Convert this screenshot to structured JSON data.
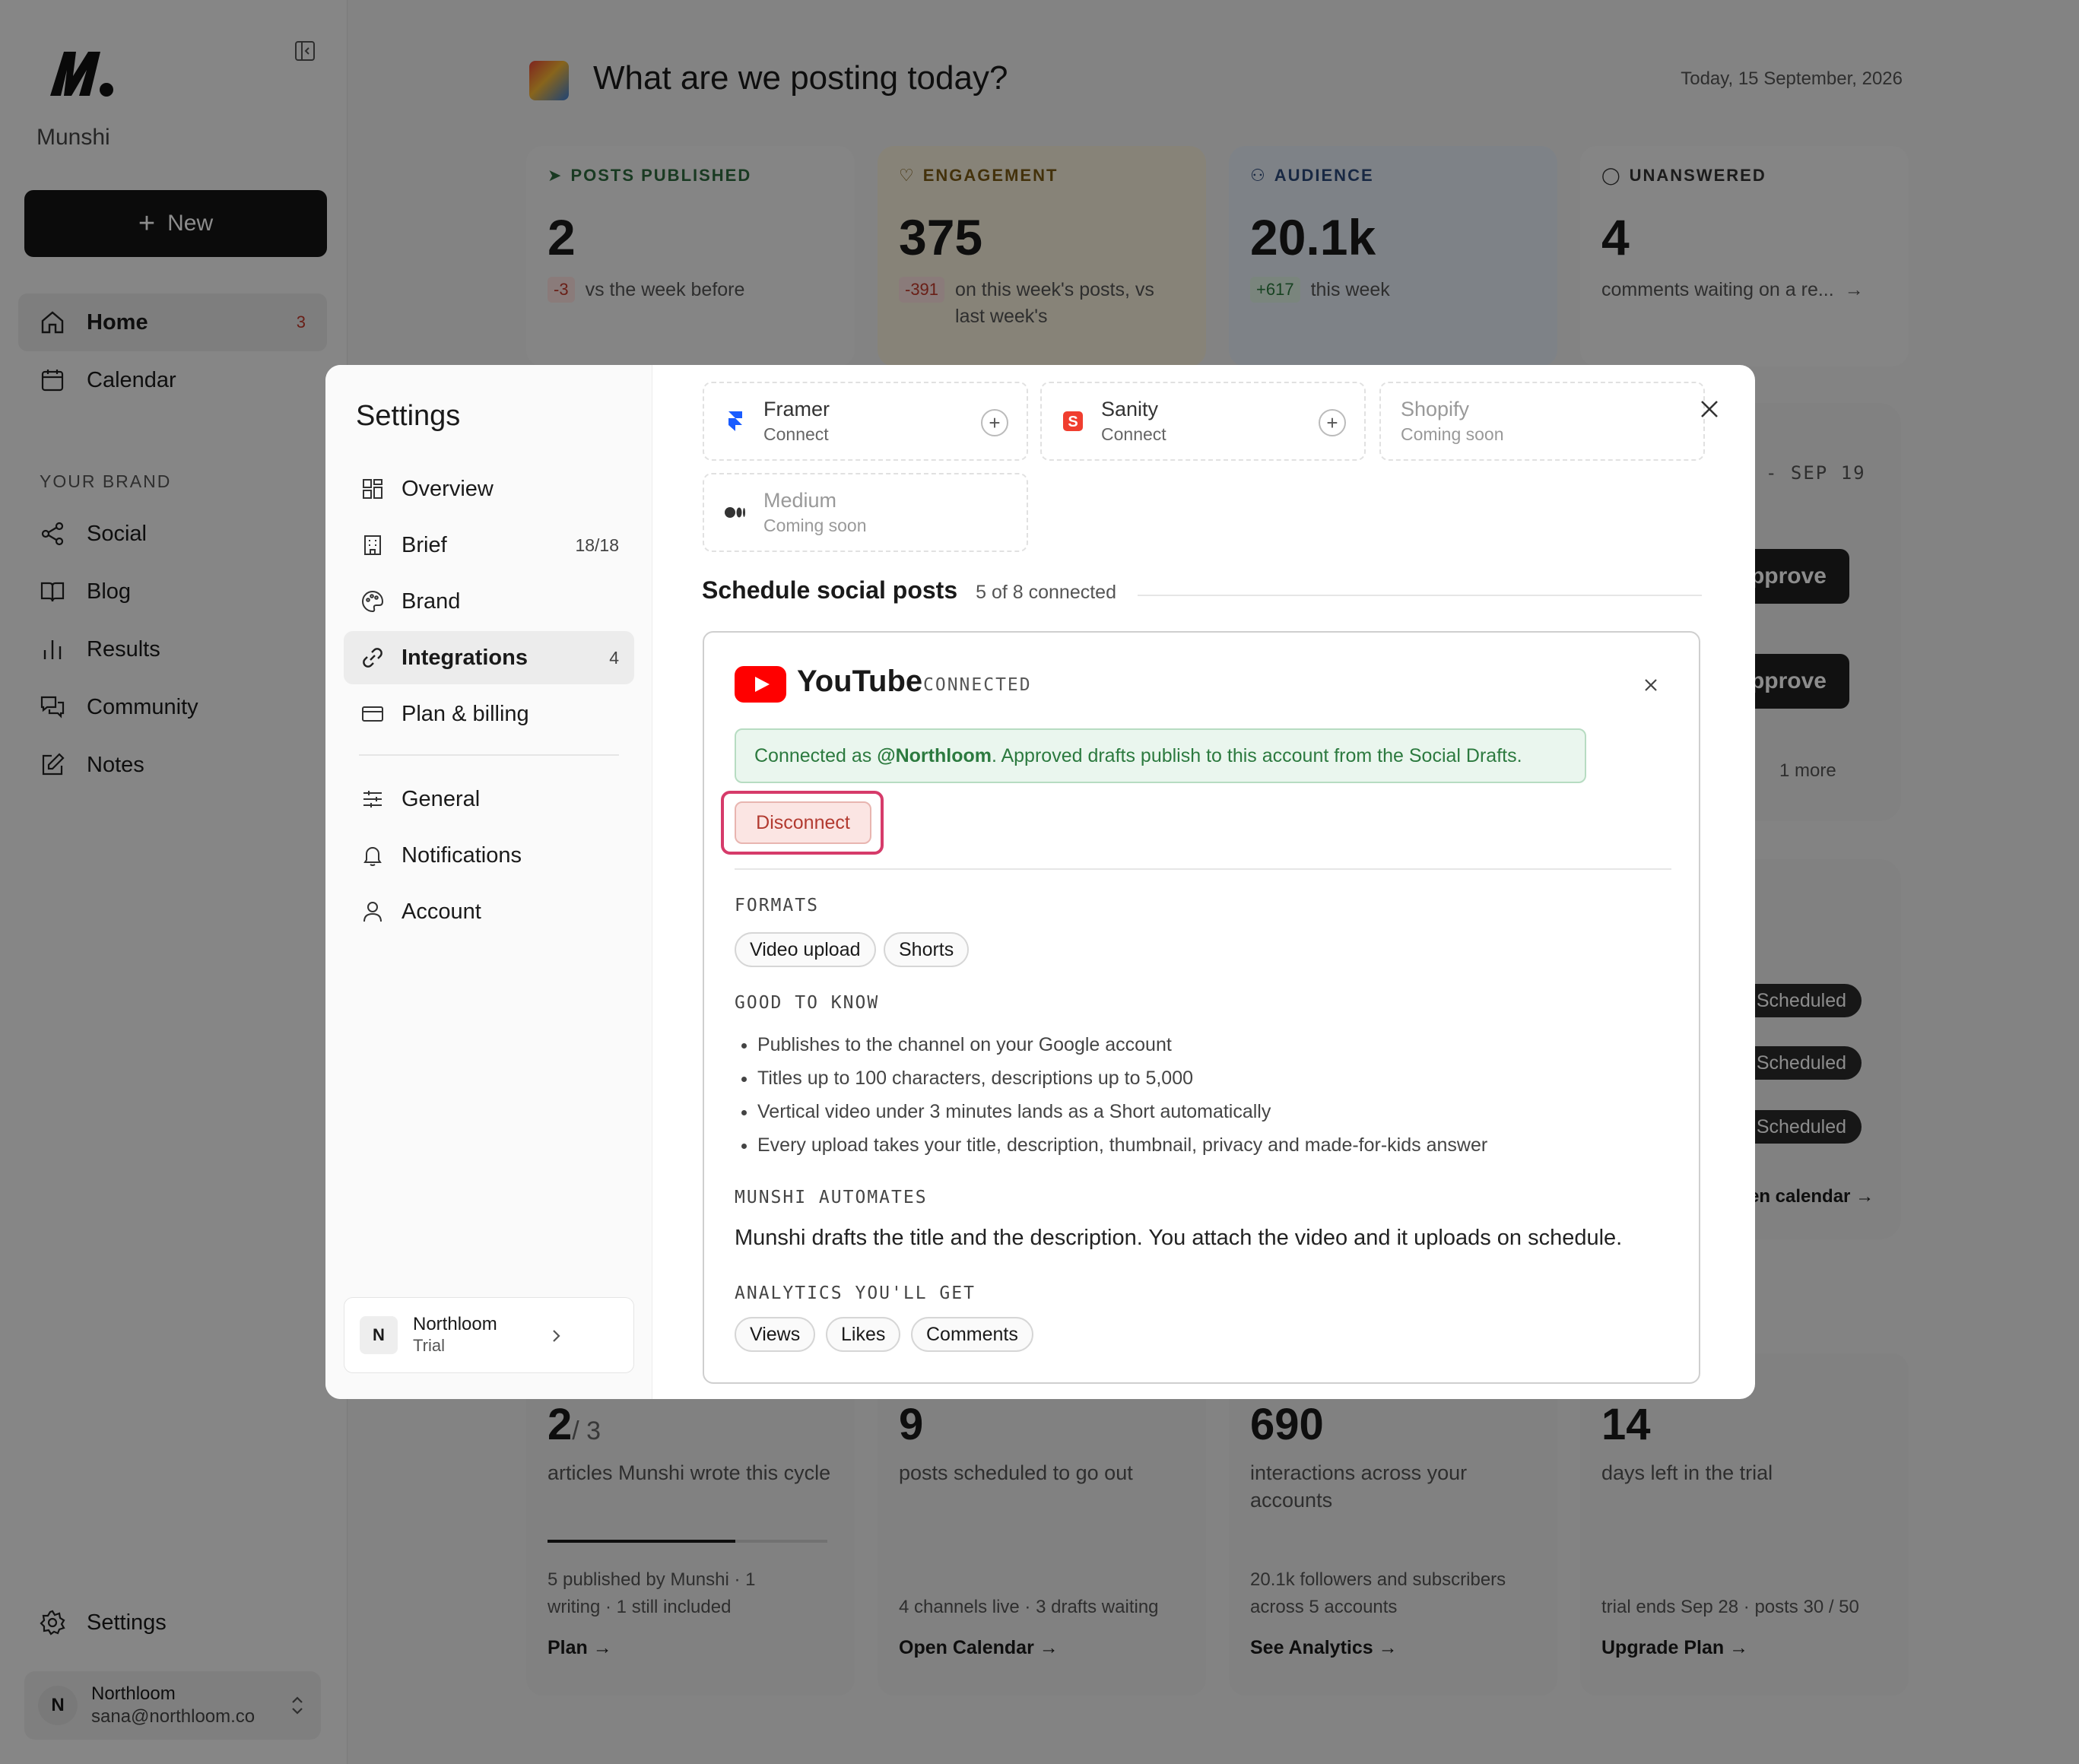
{
  "sidebar": {
    "brand": "Munshi",
    "new_label": "New",
    "nav": [
      {
        "label": "Home",
        "badge": "3"
      },
      {
        "label": "Calendar"
      }
    ],
    "section_label": "YOUR BRAND",
    "brand_nav": [
      {
        "label": "Social"
      },
      {
        "label": "Blog"
      },
      {
        "label": "Results"
      },
      {
        "label": "Community"
      },
      {
        "label": "Notes"
      }
    ],
    "settings_label": "Settings",
    "user": {
      "initial": "N",
      "name": "Northloom",
      "email": "sana@northloom.co"
    }
  },
  "main": {
    "title": "What are we posting today?",
    "date": "Today, 15 September, 2026",
    "stats": [
      {
        "label": "POSTS PUBLISHED",
        "value": "2",
        "delta": "-3",
        "note": "vs the week before",
        "color": "#2f6b3e"
      },
      {
        "label": "ENGAGEMENT",
        "value": "375",
        "delta": "-391",
        "note": "on this week's posts, vs last week's",
        "color": "#7a5a14"
      },
      {
        "label": "AUDIENCE",
        "value": "20.1k",
        "delta": "+617",
        "note": "this week",
        "color": "#2c4a7a"
      },
      {
        "label": "UNANSWERED",
        "value": "4",
        "note": "comments waiting on a re...",
        "color": "#333"
      }
    ],
    "right_panel": {
      "date_range": "- SEP 19",
      "approve_label": "pprove",
      "more": "1 more",
      "scheduled_label": "Scheduled",
      "calendar_link": "en calendar →"
    },
    "bottom_cards": [
      {
        "value": "2",
        "total": "/ 3",
        "desc": "articles Munshi wrote this cycle",
        "foot": "5 published by Munshi · 1 writing · 1 still included",
        "link": "Plan →",
        "progress": 0.67
      },
      {
        "value": "9",
        "desc": "posts scheduled to go out",
        "foot": "4 channels live · 3 drafts waiting",
        "link": "Open Calendar →"
      },
      {
        "value": "690",
        "desc": "interactions across your accounts",
        "foot": "20.1k followers and subscribers across 5 accounts",
        "link": "See Analytics →"
      },
      {
        "value": "14",
        "desc": "days left in the trial",
        "foot": "trial ends Sep 28 · posts 30 / 50",
        "link": "Upgrade Plan →"
      }
    ]
  },
  "modal": {
    "title": "Settings",
    "nav": [
      {
        "label": "Overview"
      },
      {
        "label": "Brief",
        "count": "18/18"
      },
      {
        "label": "Brand"
      },
      {
        "label": "Integrations",
        "count": "4"
      },
      {
        "label": "Plan & billing"
      },
      {
        "label": "General"
      },
      {
        "label": "Notifications"
      },
      {
        "label": "Account"
      }
    ],
    "user": {
      "initial": "N",
      "name": "Northloom",
      "plan": "Trial"
    },
    "integrations": [
      {
        "name": "Framer",
        "status": "Connect"
      },
      {
        "name": "Sanity",
        "status": "Connect"
      },
      {
        "name": "Shopify",
        "status": "Coming soon"
      },
      {
        "name": "Medium",
        "status": "Coming soon"
      }
    ],
    "schedule": {
      "heading": "Schedule social posts",
      "count": "5 of 8 connected"
    },
    "youtube": {
      "name": "YouTube",
      "status": "CONNECTED",
      "connected_prefix": "Connected as ",
      "handle": "@Northloom",
      "connected_suffix": ". Approved drafts publish to this account from the Social Drafts.",
      "disconnect": "Disconnect",
      "formats_heading": "FORMATS",
      "formats": [
        "Video upload",
        "Shorts"
      ],
      "know_heading": "GOOD TO KNOW",
      "know": [
        "Publishes to the channel on your Google account",
        "Titles up to 100 characters, descriptions up to 5,000",
        "Vertical video under 3 minutes lands as a Short automatically",
        "Every upload takes your title, description, thumbnail, privacy and made-for-kids answer"
      ],
      "automates_heading": "MUNSHI AUTOMATES",
      "automates": "Munshi drafts the title and the description. You attach the video and it uploads on schedule.",
      "analytics_heading": "ANALYTICS YOU'LL GET",
      "analytics": [
        "Views",
        "Likes",
        "Comments"
      ]
    }
  }
}
